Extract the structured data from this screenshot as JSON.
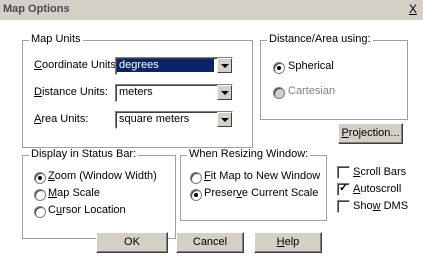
{
  "window": {
    "title": "Map Options",
    "close_glyph": "X"
  },
  "map_units": {
    "legend": "Map Units",
    "coordinate": {
      "label_pre": "",
      "label_u": "C",
      "label_post": "oordinate Units:",
      "value": "degrees"
    },
    "distance": {
      "label_pre": "",
      "label_u": "D",
      "label_post": "istance Units:",
      "value": "meters"
    },
    "area": {
      "label_pre": "",
      "label_u": "A",
      "label_post": "rea Units:",
      "value": "square meters"
    }
  },
  "distance_area": {
    "legend": "Distance/Area using:",
    "options": [
      {
        "label": "Spherical",
        "selected": true,
        "enabled": true
      },
      {
        "label": "Cartesian",
        "selected": false,
        "enabled": false
      }
    ]
  },
  "projection_button": {
    "label_pre": "",
    "label_u": "P",
    "label_post": "rojection..."
  },
  "status_bar": {
    "legend": "Display in Status Bar:",
    "options": [
      {
        "label_u": "Z",
        "label_post": "oom (Window Width)",
        "selected": true
      },
      {
        "label_u": "M",
        "label_post": "ap Scale",
        "selected": false
      },
      {
        "label_pre": "C",
        "label_u": "u",
        "label_post": "rsor Location",
        "selected": false
      }
    ]
  },
  "resizing": {
    "legend": "When Resizing Window:",
    "options": [
      {
        "label_u": "F",
        "label_post": "it Map to New Window",
        "selected": false
      },
      {
        "label_pre": "Preser",
        "label_u": "v",
        "label_post": "e Current Scale",
        "selected": true
      }
    ]
  },
  "checkboxes": [
    {
      "label_u": "S",
      "label_post": "croll Bars",
      "checked": false
    },
    {
      "label_u": "A",
      "label_post": "utoscroll",
      "checked": true
    },
    {
      "label_pre": "Sho",
      "label_u": "w",
      "label_post": " DMS",
      "checked": false
    }
  ],
  "buttons": {
    "ok": "OK",
    "cancel": "Cancel",
    "help_u": "H",
    "help_post": "elp"
  }
}
